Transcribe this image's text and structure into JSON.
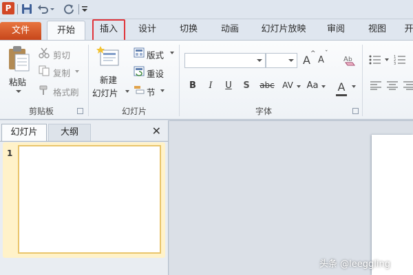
{
  "app": {
    "icon_letter": "P"
  },
  "quick_access": {
    "items": [
      "save-icon",
      "undo-icon",
      "redo-icon",
      "customize-icon"
    ]
  },
  "tabs": [
    "文件",
    "开始",
    "插入",
    "设计",
    "切换",
    "动画",
    "幻灯片放映",
    "审阅",
    "视图",
    "开"
  ],
  "ribbon": {
    "clipboard": {
      "paste": "粘贴",
      "cut": "剪切",
      "copy": "复制",
      "format_painter": "格式刷",
      "label": "剪贴板"
    },
    "slides": {
      "new_slide_line1": "新建",
      "new_slide_line2": "幻灯片",
      "layout": "版式",
      "reset": "重设",
      "section": "节",
      "label": "幻灯片"
    },
    "font": {
      "font_name": "",
      "font_size": "",
      "grow": "A",
      "shrink": "A",
      "bold": "B",
      "italic": "I",
      "underline": "U",
      "shadow": "S",
      "strike": "abc",
      "spacing": "AV",
      "change_case": "Aa",
      "color": "A",
      "label": "字体"
    }
  },
  "panel": {
    "tab_slides": "幻灯片",
    "tab_outline": "大纲",
    "close": "✕",
    "slide_number": "1"
  },
  "watermark": "头条 @leeggling",
  "colors": {
    "file_tab": "#d24726",
    "highlight": "#e0343a",
    "thumb_border": "#e9c46a"
  }
}
